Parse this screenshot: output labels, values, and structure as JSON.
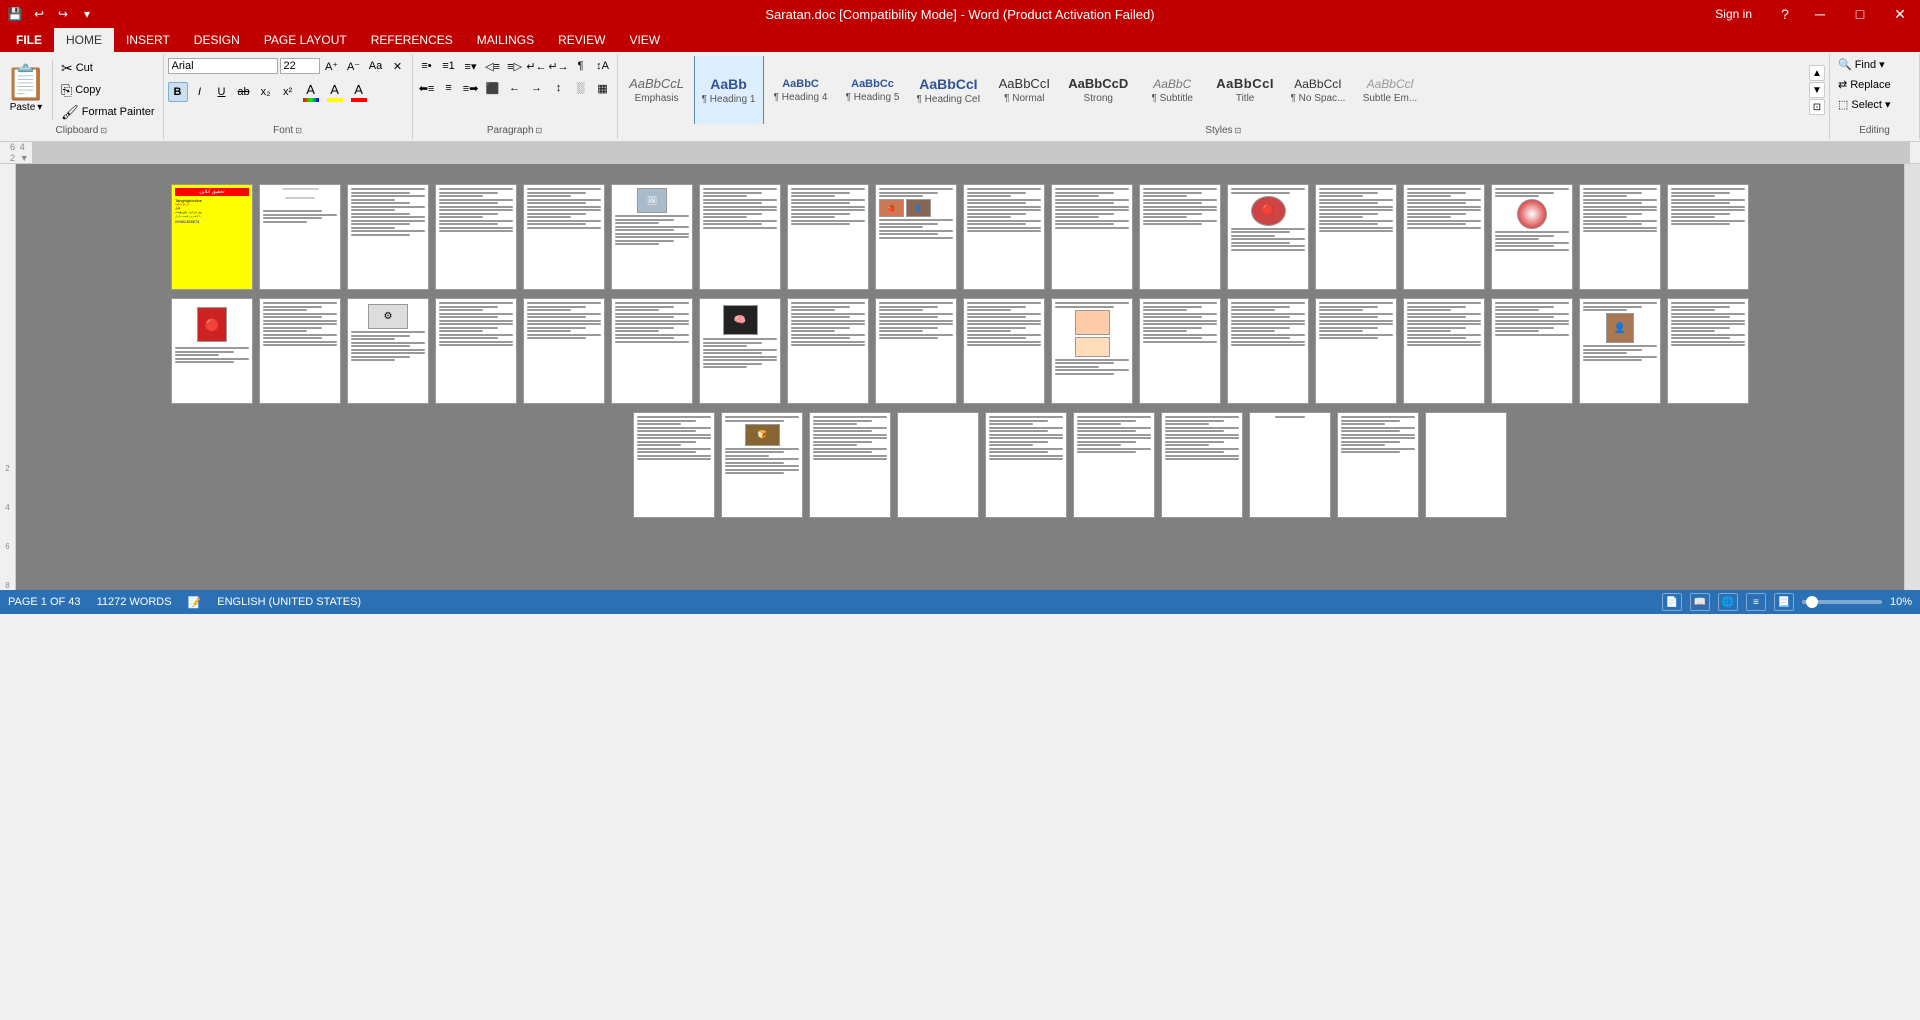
{
  "titlebar": {
    "title": "Saratan.doc [Compatibility Mode] - Word (Product Activation Failed)",
    "help": "?",
    "signin": "Sign in",
    "minimize": "─",
    "maximize": "□",
    "close": "✕"
  },
  "quickaccess": {
    "save": "💾",
    "undo": "↩",
    "redo": "↪",
    "customize": "▾"
  },
  "tabs": [
    "FILE",
    "HOME",
    "INSERT",
    "DESIGN",
    "PAGE LAYOUT",
    "REFERENCES",
    "MAILINGS",
    "REVIEW",
    "VIEW"
  ],
  "activeTab": "HOME",
  "clipboard": {
    "label": "Clipboard",
    "paste_label": "Paste",
    "paste_arrow": "▾",
    "cut": "Cut",
    "copy": "Copy",
    "format_painter": "Format Painter"
  },
  "font": {
    "label": "Font",
    "name": "Arial",
    "size": "22",
    "grow": "A",
    "shrink": "a",
    "change_case": "Aa",
    "clear": "✕",
    "bold": "B",
    "italic": "I",
    "underline": "U",
    "strikethrough": "abc",
    "subscript": "x₂",
    "superscript": "x²",
    "effects": "A",
    "highlight": "A",
    "color": "A",
    "highlight_color": "#ffff00",
    "font_color": "#ff0000"
  },
  "paragraph": {
    "label": "Paragraph",
    "bullets": "≡",
    "numbering": "≡",
    "multi": "≡",
    "decrease": "◁",
    "increase": "▷",
    "ltr": "↵",
    "rtl": "↵",
    "show_hide": "¶",
    "sort": "↕",
    "align_left": "≡",
    "align_center": "≡",
    "align_right": "≡",
    "justify": "≡",
    "ltr2": "←",
    "rtl2": "→",
    "line_spacing": "↕",
    "shading": "░",
    "borders": "▦"
  },
  "styles": {
    "label": "Styles",
    "items": [
      {
        "id": "emphasis",
        "label": "Emphasis",
        "class": "style-emphasis",
        "text": "AaBbCcL"
      },
      {
        "id": "heading1",
        "label": "¶ Heading 1",
        "class": "style-h1",
        "text": "AaBb",
        "active": true
      },
      {
        "id": "heading4",
        "label": "¶ Heading 4",
        "class": "style-h4",
        "text": "AaBbC"
      },
      {
        "id": "heading5",
        "label": "¶ Heading 5",
        "class": "style-h5",
        "text": "AaBbCc"
      },
      {
        "id": "heading-ci",
        "label": "¶ Heading CeI",
        "class": "style-h1",
        "text": "AaBbCcI"
      },
      {
        "id": "normal",
        "label": "¶ Normal",
        "class": "style-normal",
        "text": "AaBbCcI"
      },
      {
        "id": "strong",
        "label": "Strong",
        "class": "style-strong",
        "text": "AaBbCcD"
      },
      {
        "id": "subtitle",
        "label": "¶ Subtitle",
        "class": "style-subtitle",
        "text": "AaBbC"
      },
      {
        "id": "title",
        "label": "Title",
        "class": "style-title",
        "text": "AaBbCcI"
      },
      {
        "id": "nospace",
        "label": "¶ No Spac...",
        "class": "style-nospace",
        "text": "AaBbCcI"
      },
      {
        "id": "subtleem",
        "label": "Subtle Em...",
        "class": "style-subtle-em",
        "text": "AaBbCcl"
      }
    ]
  },
  "editing": {
    "label": "Editing",
    "find": "Find",
    "find_arrow": "▾",
    "replace": "Replace",
    "select": "Select",
    "select_arrow": "▾"
  },
  "ruler": {
    "markers": [
      "6",
      "4",
      "2"
    ]
  },
  "statusbar": {
    "page": "PAGE 1 OF 43",
    "words": "11272 WORDS",
    "language": "ENGLISH (UNITED STATES)",
    "zoom": "10%"
  },
  "pages": {
    "row1_count": 18,
    "row2_count": 18,
    "row3_count": 10
  }
}
